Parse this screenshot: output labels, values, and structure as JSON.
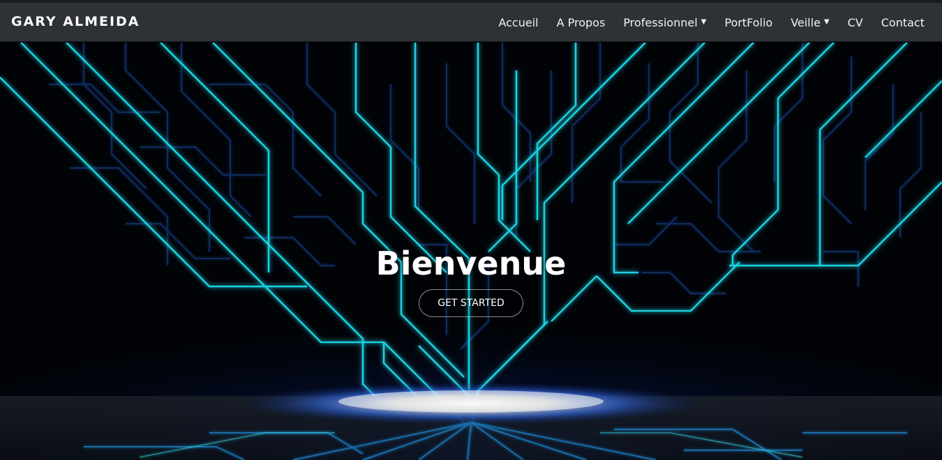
{
  "navbar": {
    "brand": "GARY ALMEIDA",
    "links": [
      {
        "label": "Accueil",
        "dropdown": false
      },
      {
        "label": "A Propos",
        "dropdown": false
      },
      {
        "label": "Professionnel",
        "dropdown": true
      },
      {
        "label": "PortFolio",
        "dropdown": false
      },
      {
        "label": "Veille",
        "dropdown": true
      },
      {
        "label": "CV",
        "dropdown": false
      },
      {
        "label": "Contact",
        "dropdown": false
      }
    ],
    "caret_icon": "caret-down-icon"
  },
  "hero": {
    "title": "Bienvenue",
    "cta_label": "GET STARTED",
    "background": "circuit-board-background"
  },
  "colors": {
    "navbar_bg": "#2e3236",
    "circuit_line": "#1fd0e0",
    "circuit_glow": "#1e5bd8",
    "hero_bg": "#010307"
  }
}
